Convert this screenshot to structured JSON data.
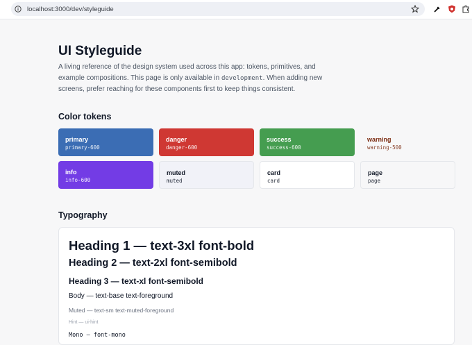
{
  "browser": {
    "url": "localhost:3000/dev/styleguide"
  },
  "page": {
    "title": "UI Styleguide",
    "description_before": "A living reference of the design system used across this app: tokens, primitives, and example compositions. This page is only available in ",
    "description_code": "development",
    "description_after": ". When adding new screens, prefer reaching for these components first to keep things consistent."
  },
  "color_tokens": {
    "title": "Color tokens",
    "items": [
      {
        "name": "primary",
        "var": "primary-600",
        "bg": "#3b6db4",
        "fg": "#ffffff"
      },
      {
        "name": "danger",
        "var": "danger-600",
        "bg": "#cf3833",
        "fg": "#ffffff"
      },
      {
        "name": "success",
        "var": "success-600",
        "bg": "#459d50",
        "fg": "#ffffff"
      },
      {
        "name": "warning",
        "var": "warning-500",
        "bg": "#f7f7f8",
        "fg": "#7c2d12"
      },
      {
        "name": "info",
        "var": "info-600",
        "bg": "#733ce5",
        "fg": "#ffffff"
      },
      {
        "name": "muted",
        "var": "muted",
        "bg": "#f1f2f8",
        "fg": "#111827"
      },
      {
        "name": "card",
        "var": "card",
        "bg": "#ffffff",
        "fg": "#111827"
      },
      {
        "name": "page",
        "var": "page",
        "bg": "#f7f7f8",
        "fg": "#111827"
      }
    ]
  },
  "typography": {
    "title": "Typography",
    "h1": "Heading 1 — text-3xl font-bold",
    "h2": "Heading 2 — text-2xl font-semibold",
    "h3": "Heading 3 — text-xl font-semibold",
    "body": "Body — text-base text-foreground",
    "muted": "Muted — text-sm text-muted-foreground",
    "hint": "Hint — ui-hint",
    "mono": "Mono — font-mono"
  }
}
